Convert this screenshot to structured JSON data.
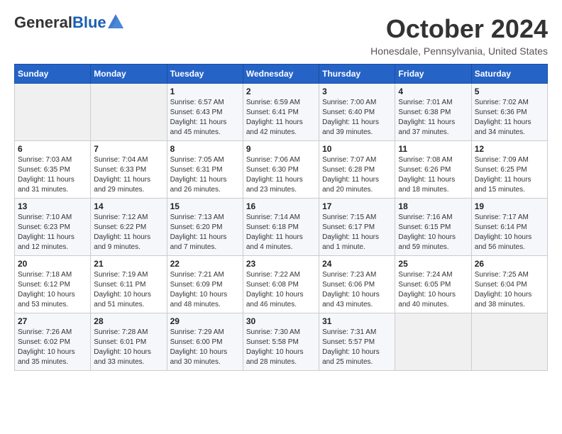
{
  "header": {
    "logo_line1": "General",
    "logo_line2": "Blue",
    "month": "October 2024",
    "location": "Honesdale, Pennsylvania, United States"
  },
  "days_of_week": [
    "Sunday",
    "Monday",
    "Tuesday",
    "Wednesday",
    "Thursday",
    "Friday",
    "Saturday"
  ],
  "weeks": [
    [
      {
        "day": "",
        "info": ""
      },
      {
        "day": "",
        "info": ""
      },
      {
        "day": "1",
        "info": "Sunrise: 6:57 AM\nSunset: 6:43 PM\nDaylight: 11 hours and 45 minutes."
      },
      {
        "day": "2",
        "info": "Sunrise: 6:59 AM\nSunset: 6:41 PM\nDaylight: 11 hours and 42 minutes."
      },
      {
        "day": "3",
        "info": "Sunrise: 7:00 AM\nSunset: 6:40 PM\nDaylight: 11 hours and 39 minutes."
      },
      {
        "day": "4",
        "info": "Sunrise: 7:01 AM\nSunset: 6:38 PM\nDaylight: 11 hours and 37 minutes."
      },
      {
        "day": "5",
        "info": "Sunrise: 7:02 AM\nSunset: 6:36 PM\nDaylight: 11 hours and 34 minutes."
      }
    ],
    [
      {
        "day": "6",
        "info": "Sunrise: 7:03 AM\nSunset: 6:35 PM\nDaylight: 11 hours and 31 minutes."
      },
      {
        "day": "7",
        "info": "Sunrise: 7:04 AM\nSunset: 6:33 PM\nDaylight: 11 hours and 29 minutes."
      },
      {
        "day": "8",
        "info": "Sunrise: 7:05 AM\nSunset: 6:31 PM\nDaylight: 11 hours and 26 minutes."
      },
      {
        "day": "9",
        "info": "Sunrise: 7:06 AM\nSunset: 6:30 PM\nDaylight: 11 hours and 23 minutes."
      },
      {
        "day": "10",
        "info": "Sunrise: 7:07 AM\nSunset: 6:28 PM\nDaylight: 11 hours and 20 minutes."
      },
      {
        "day": "11",
        "info": "Sunrise: 7:08 AM\nSunset: 6:26 PM\nDaylight: 11 hours and 18 minutes."
      },
      {
        "day": "12",
        "info": "Sunrise: 7:09 AM\nSunset: 6:25 PM\nDaylight: 11 hours and 15 minutes."
      }
    ],
    [
      {
        "day": "13",
        "info": "Sunrise: 7:10 AM\nSunset: 6:23 PM\nDaylight: 11 hours and 12 minutes."
      },
      {
        "day": "14",
        "info": "Sunrise: 7:12 AM\nSunset: 6:22 PM\nDaylight: 11 hours and 9 minutes."
      },
      {
        "day": "15",
        "info": "Sunrise: 7:13 AM\nSunset: 6:20 PM\nDaylight: 11 hours and 7 minutes."
      },
      {
        "day": "16",
        "info": "Sunrise: 7:14 AM\nSunset: 6:18 PM\nDaylight: 11 hours and 4 minutes."
      },
      {
        "day": "17",
        "info": "Sunrise: 7:15 AM\nSunset: 6:17 PM\nDaylight: 11 hours and 1 minute."
      },
      {
        "day": "18",
        "info": "Sunrise: 7:16 AM\nSunset: 6:15 PM\nDaylight: 10 hours and 59 minutes."
      },
      {
        "day": "19",
        "info": "Sunrise: 7:17 AM\nSunset: 6:14 PM\nDaylight: 10 hours and 56 minutes."
      }
    ],
    [
      {
        "day": "20",
        "info": "Sunrise: 7:18 AM\nSunset: 6:12 PM\nDaylight: 10 hours and 53 minutes."
      },
      {
        "day": "21",
        "info": "Sunrise: 7:19 AM\nSunset: 6:11 PM\nDaylight: 10 hours and 51 minutes."
      },
      {
        "day": "22",
        "info": "Sunrise: 7:21 AM\nSunset: 6:09 PM\nDaylight: 10 hours and 48 minutes."
      },
      {
        "day": "23",
        "info": "Sunrise: 7:22 AM\nSunset: 6:08 PM\nDaylight: 10 hours and 46 minutes."
      },
      {
        "day": "24",
        "info": "Sunrise: 7:23 AM\nSunset: 6:06 PM\nDaylight: 10 hours and 43 minutes."
      },
      {
        "day": "25",
        "info": "Sunrise: 7:24 AM\nSunset: 6:05 PM\nDaylight: 10 hours and 40 minutes."
      },
      {
        "day": "26",
        "info": "Sunrise: 7:25 AM\nSunset: 6:04 PM\nDaylight: 10 hours and 38 minutes."
      }
    ],
    [
      {
        "day": "27",
        "info": "Sunrise: 7:26 AM\nSunset: 6:02 PM\nDaylight: 10 hours and 35 minutes."
      },
      {
        "day": "28",
        "info": "Sunrise: 7:28 AM\nSunset: 6:01 PM\nDaylight: 10 hours and 33 minutes."
      },
      {
        "day": "29",
        "info": "Sunrise: 7:29 AM\nSunset: 6:00 PM\nDaylight: 10 hours and 30 minutes."
      },
      {
        "day": "30",
        "info": "Sunrise: 7:30 AM\nSunset: 5:58 PM\nDaylight: 10 hours and 28 minutes."
      },
      {
        "day": "31",
        "info": "Sunrise: 7:31 AM\nSunset: 5:57 PM\nDaylight: 10 hours and 25 minutes."
      },
      {
        "day": "",
        "info": ""
      },
      {
        "day": "",
        "info": ""
      }
    ]
  ]
}
